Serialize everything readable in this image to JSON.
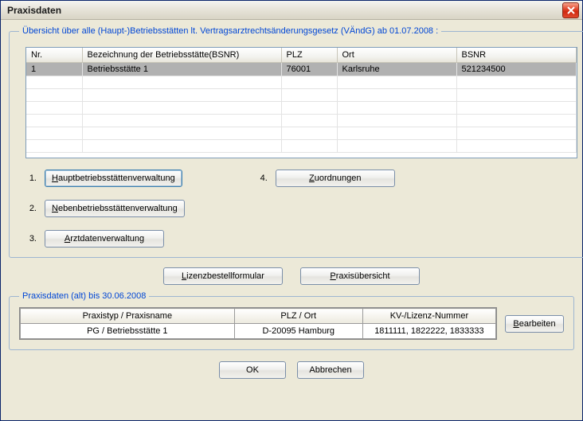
{
  "window": {
    "title": "Praxisdaten"
  },
  "main_group": {
    "legend": "Übersicht über alle (Haupt-)Betriebsstätten lt. Vertragsarztrechtsänderungsgesetz (VÄndG) ab 01.07.2008 :"
  },
  "table": {
    "headers": {
      "nr": "Nr.",
      "bezeichnung": "Bezeichnung der Betriebsstätte(BSNR)",
      "plz": "PLZ",
      "ort": "Ort",
      "bsnr": "BSNR"
    },
    "rows": [
      {
        "nr": "1",
        "bezeichnung": "Betriebsstätte 1",
        "plz": "76001",
        "ort": "Karlsruhe",
        "bsnr": "521234500"
      }
    ]
  },
  "actions": {
    "n1": "1.",
    "n2": "2.",
    "n3": "3.",
    "n4": "4.",
    "b1": "Hauptbetriebsstättenverwaltung",
    "b2": "Nebenbetriebsstättenverwaltung",
    "b3": "Arztdatenverwaltung",
    "b4": "Zuordnungen"
  },
  "mid": {
    "lizenz": "Lizenzbestellformular",
    "praxis": "Praxisübersicht"
  },
  "old_group": {
    "legend": "Praxisdaten (alt) bis 30.06.2008"
  },
  "old_table": {
    "headers": {
      "typ": "Praxistyp / Praxisname",
      "plz_ort": "PLZ / Ort",
      "kv": "KV-/Lizenz-Nummer"
    },
    "row": {
      "typ": "PG  / Betriebsstätte 1",
      "plz_ort": "D-20095 Hamburg",
      "kv": "1811111, 1822222, 1833333"
    },
    "edit": "Bearbeiten"
  },
  "bottom": {
    "ok": "OK",
    "cancel": "Abbrechen"
  }
}
